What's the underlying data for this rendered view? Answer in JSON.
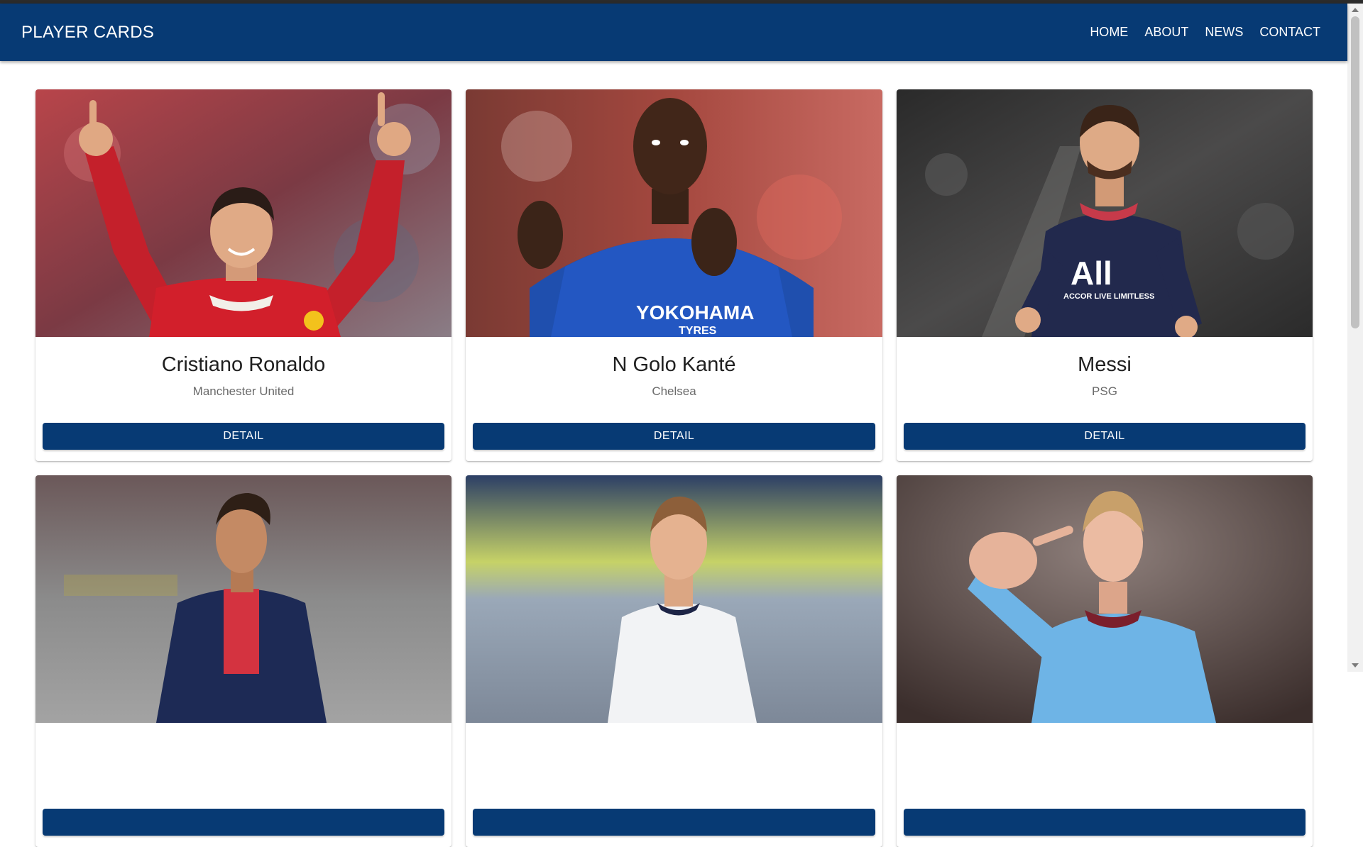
{
  "appbar": {
    "brand": "PLAYER CARDS",
    "nav": [
      "HOME",
      "ABOUT",
      "NEWS",
      "CONTACT"
    ]
  },
  "colors": {
    "primary": "#073a74",
    "text_dark": "#1f1f1f",
    "text_muted": "#6a6a6a"
  },
  "players": [
    {
      "name": "Cristiano Ronaldo",
      "club": "Manchester United",
      "button": "DETAIL",
      "photo": "player-photo-ronaldo"
    },
    {
      "name": "N Golo Kanté",
      "club": "Chelsea",
      "button": "DETAIL",
      "photo": "player-photo-kante"
    },
    {
      "name": "Messi",
      "club": "PSG",
      "button": "DETAIL",
      "photo": "player-photo-messi"
    },
    {
      "name": "",
      "club": "",
      "button": "",
      "photo": "player-photo-neymar"
    },
    {
      "name": "",
      "club": "",
      "button": "",
      "photo": "player-photo-kane"
    },
    {
      "name": "",
      "club": "",
      "button": "",
      "photo": "player-photo-haaland"
    }
  ]
}
